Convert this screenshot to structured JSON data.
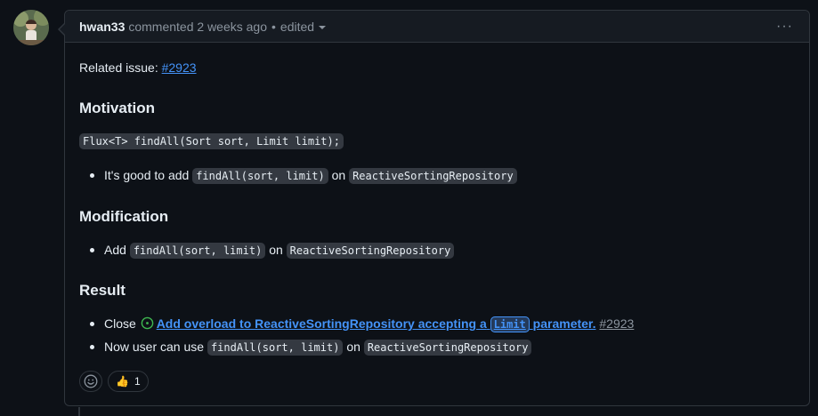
{
  "comment": {
    "author": "hwan33",
    "meta": "commented 2 weeks ago",
    "separator": "•",
    "edited": "edited",
    "more_options": "···"
  },
  "body": {
    "related_label": "Related issue:",
    "related_link": "#2923",
    "motivation_heading": "Motivation",
    "motivation_code": "Flux<T> findAll(Sort sort, Limit limit);",
    "motivation_item": {
      "text1": "It's good to add",
      "code1": "findAll(sort, limit)",
      "text2": "on",
      "code2": "ReactiveSortingRepository"
    },
    "modification_heading": "Modification",
    "modification_item": {
      "text1": "Add",
      "code1": "findAll(sort, limit)",
      "text2": "on",
      "code2": "ReactiveSortingRepository"
    },
    "result_heading": "Result",
    "result_item1": {
      "text1": "Close",
      "link_text": "Add overload to ReactiveSortingRepository accepting a",
      "link_code": "Limit",
      "link_text2": "parameter.",
      "issue_number": "#2923"
    },
    "result_item2": {
      "text1": "Now user can use",
      "code1": "findAll(sort, limit)",
      "text2": "on",
      "code2": "ReactiveSortingRepository"
    }
  },
  "reactions": {
    "thumbs_up_emoji": "👍",
    "thumbs_up_count": "1"
  },
  "icons": {
    "add_reaction": "smiley-icon",
    "open_issue": "issue-opened-icon",
    "more": "kebab-horizontal-icon"
  },
  "colors": {
    "background": "#0d1117",
    "link": "#4493f8",
    "open_issue": "#3fb950"
  }
}
